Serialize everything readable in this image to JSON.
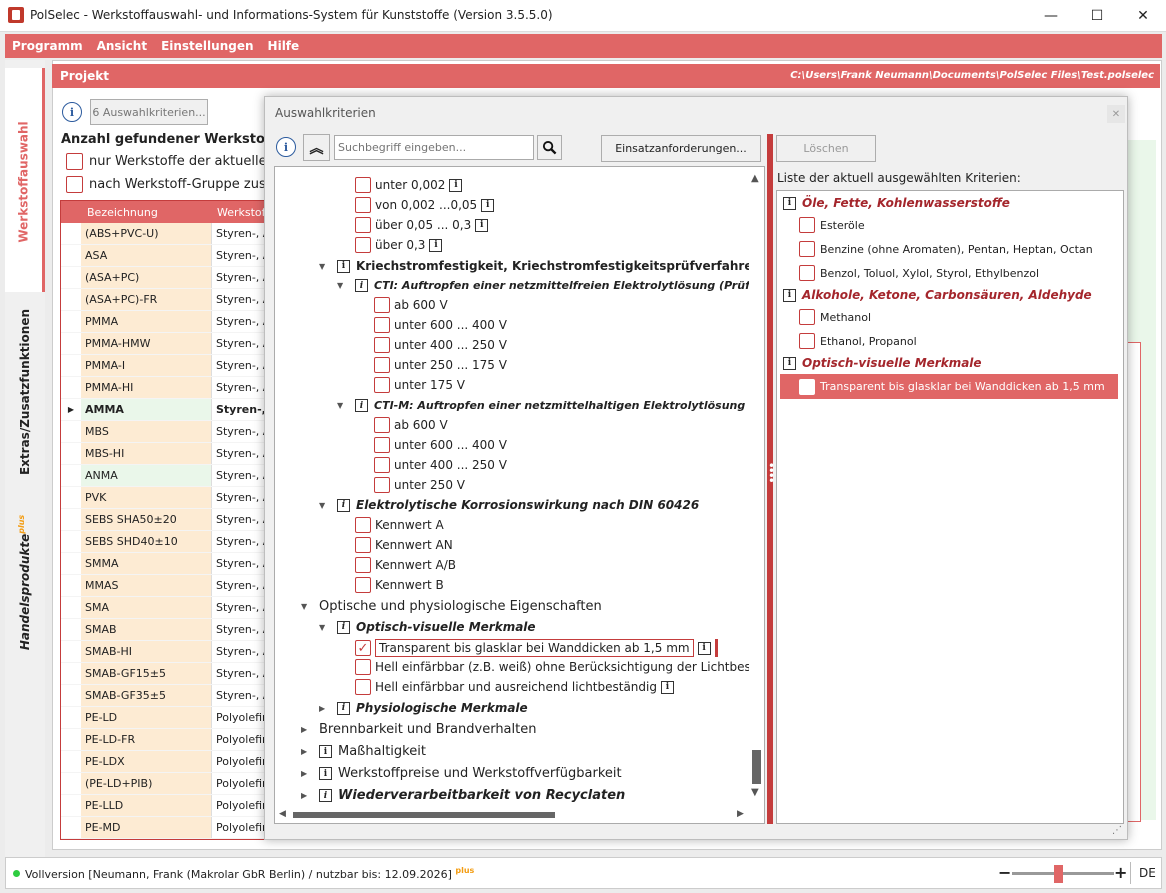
{
  "window": {
    "title": "PolSelec - Werkstoffauswahl- und Informations-System für Kunststoffe (Version 3.5.5.0)",
    "min": "—",
    "max": "☐",
    "close": "✕"
  },
  "menu": [
    "Programm",
    "Ansicht",
    "Einstellungen",
    "Hilfe"
  ],
  "left_tabs": {
    "tab1": "Werkstoffauswahl",
    "tab2": "Extras/Zusatzfunktionen",
    "tab3": "Handelsprodukte",
    "tab3_sup": "plus"
  },
  "project": {
    "label": "Projekt",
    "path": "C:\\Users\\Frank Neumann\\Documents\\PolSelec Files\\Test.polselec"
  },
  "main": {
    "criteria_button": "6 Auswahlkriterien...",
    "found_label": "Anzahl gefundener Werkstoffe:",
    "option1": "nur Werkstoffe der aktuellen",
    "option2": "nach Werkstoff-Gruppe zusar",
    "col_name": "Bezeichnung",
    "col_type": "Werkstoff",
    "rows": [
      [
        "(ABS+PVC-U)",
        "Styren-, A"
      ],
      [
        "ASA",
        "Styren-, A"
      ],
      [
        "(ASA+PC)",
        "Styren-, A"
      ],
      [
        "(ASA+PC)-FR",
        "Styren-, A"
      ],
      [
        "PMMA",
        "Styren-, A"
      ],
      [
        "PMMA-HMW",
        "Styren-, A"
      ],
      [
        "PMMA-I",
        "Styren-, A"
      ],
      [
        "PMMA-HI",
        "Styren-, A"
      ],
      [
        "AMMA",
        "Styren-, A"
      ],
      [
        "MBS",
        "Styren-, A"
      ],
      [
        "MBS-HI",
        "Styren-, A"
      ],
      [
        "ANMA",
        "Styren-, A"
      ],
      [
        "PVK",
        "Styren-, A"
      ],
      [
        "SEBS SHA50±20",
        "Styren-, A"
      ],
      [
        "SEBS SHD40±10",
        "Styren-, A"
      ],
      [
        "SMMA",
        "Styren-, A"
      ],
      [
        "MMAS",
        "Styren-, A"
      ],
      [
        "SMA",
        "Styren-, A"
      ],
      [
        "SMAB",
        "Styren-, A"
      ],
      [
        "SMAB-HI",
        "Styren-, A"
      ],
      [
        "SMAB-GF15±5",
        "Styren-, A"
      ],
      [
        "SMAB-GF35±5",
        "Styren-, A"
      ],
      [
        "PE-LD",
        "Polyolefin"
      ],
      [
        "PE-LD-FR",
        "Polyolefin"
      ],
      [
        "PE-LDX",
        "Polyolefin"
      ],
      [
        "(PE-LD+PIB)",
        "Polyolefin"
      ],
      [
        "PE-LLD",
        "Polyolefin"
      ],
      [
        "PE-MD",
        "Polyolefin"
      ]
    ]
  },
  "dialog": {
    "title": "Auswahlkriterien",
    "close": "✕",
    "search_placeholder": "Suchbegriff eingeben...",
    "btn_einsatz": "Einsatzanforderungen...",
    "btn_loeschen": "Löschen",
    "list_label": "Liste der aktuell ausgewählten Kriterien:"
  },
  "tree": {
    "t1": "unter 0,002",
    "t2": "von 0,002 ...0,05",
    "t3": "über 0,05 ... 0,3",
    "t4": "über 0,3",
    "kriech": "Kriechstromfestigkeit, Kriechstromfestigkeitsprüfverfahren",
    "cti": "CTI: Auftropfen einer netzmittelfreien Elektrolytlösung (Prüflös",
    "cti1": "ab 600 V",
    "cti2": "unter 600 ... 400 V",
    "cti3": "unter 400 ... 250 V",
    "cti4": "unter 250 ... 175 V",
    "cti5": "unter 175 V",
    "ctim": "CTI-M: Auftropfen einer netzmittelhaltigen Elektrolytlösung (Pr",
    "ctim1": "ab 600 V",
    "ctim2": "unter 600 ... 400 V",
    "ctim3": "unter 400 ... 250 V",
    "ctim4": "unter 250 V",
    "elektro": "Elektrolytische Korrosionswirkung nach DIN 60426",
    "kw1": "Kennwert A",
    "kw2": "Kennwert AN",
    "kw3": "Kennwert A/B",
    "kw4": "Kennwert B",
    "optisch_main": "Optische und physiologische Eigenschaften",
    "optisch": "Optisch-visuelle Merkmale",
    "o1": "Transparent bis glasklar bei Wanddicken ab 1,5 mm",
    "o2": "Hell einfärbbar (z.B. weiß) ohne Berücksichtigung der Lichtbestär",
    "o3": "Hell einfärbbar und ausreichend lichtbeständig",
    "physio": "Physiologische Merkmale",
    "brenn": "Brennbarkeit und Brandverhalten",
    "mass": "Maßhaltigkeit",
    "preise": "Werkstoffpreise und Werkstoffverfügbarkeit",
    "wieder": "Wiederverarbeitbarkeit von Recyclaten"
  },
  "selected": {
    "cat1": "Öle, Fette, Kohlenwasserstoffe",
    "c1a": "Esteröle",
    "c1b": "Benzine (ohne Aromaten), Pentan, Heptan, Octan",
    "c1c": "Benzol, Toluol, Xylol, Styrol, Ethylbenzol",
    "cat2": "Alkohole, Ketone, Carbonsäuren, Aldehyde",
    "c2a": "Methanol",
    "c2b": "Ethanol, Propanol",
    "cat3": "Optisch-visuelle Merkmale",
    "c3a": "Transparent bis glasklar bei Wanddicken ab 1,5 mm"
  },
  "status": {
    "text": "Vollversion [Neumann, Frank (Makrolar GbR Berlin) / nutzbar bis: 12.09.2026]",
    "plus": "plus",
    "zoom_minus": "−",
    "zoom_plus": "+",
    "lang": "DE",
    "zoom_level": 0.45
  },
  "colors": {
    "accent": "#e06666",
    "dark_red": "#a4262c",
    "checkbox": "#c43c3c"
  }
}
